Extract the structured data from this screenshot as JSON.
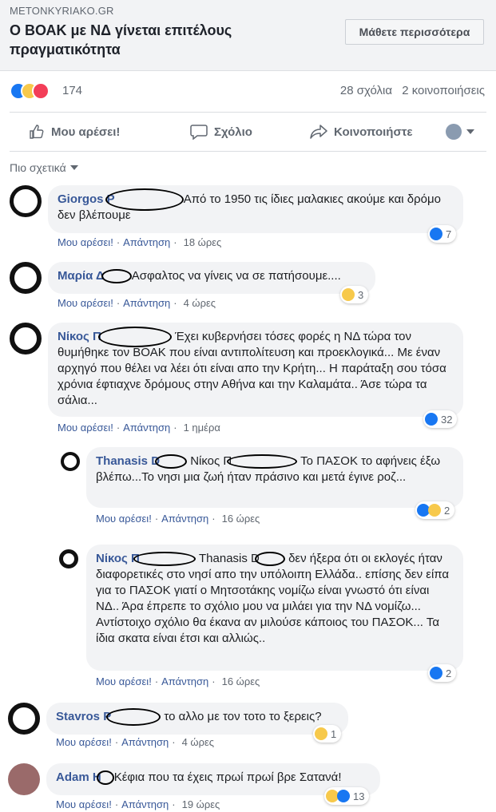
{
  "preview": {
    "domain": "METONKYRIAKO.GR",
    "title": "Ο ΒΟΑΚ με ΝΔ γίνεται επιτέλους πραγματικότητα",
    "learn_more": "Μάθετε περισσότερα"
  },
  "summary": {
    "reactions_count": "174",
    "comments": "28 σχόλια",
    "shares": "2 κοινοποιήσεις"
  },
  "actions": {
    "like": "Μου αρέσει!",
    "comment": "Σχόλιο",
    "share": "Κοινοποιήστε"
  },
  "sort_label": "Πιο σχετικά",
  "meta_like": "Μου αρέσει!",
  "meta_reply": "Απάντηση",
  "comments": [
    {
      "name": "Giorgos P",
      "text": "Από το 1950 τις ίδιες μαλακιες ακούμε και δρόμο δεν βλέπουμε",
      "time": "18 ώρες",
      "reactions": "7"
    },
    {
      "name": "Μαρία Δ",
      "text": "Ασφαλτος να γίνεις να σε πατήσουμε....",
      "time": "4 ώρες",
      "reactions": "3"
    },
    {
      "name": "Νίκος Π",
      "text": "Έχει κυβερνήσει τόσες φορές η ΝΔ τώρα τον θυμήθηκε τον ΒΟΑΚ που είναι αντιπολίτευση και προεκλογικά... Με έναν αρχηγό που θέλει να λέει ότι είναι απο την Κρήτη... Η παράταξη σου τόσα χρόνια έφτιαχνε δρόμους στην Αθήνα και την Καλαμάτα.. Άσε τώρα τα σάλια...",
      "time": "1 ημέρα",
      "reactions": "32"
    },
    {
      "name": "Thanasis D",
      "tag": "Νίκος Π",
      "text": "Το ΠΑΣΟΚ το αφήνεις έξω βλέπω...Το νησι μια ζωή ήταν πράσινο και μετά έγινε ροζ...",
      "time": "16 ώρες",
      "reactions": "2"
    },
    {
      "name": "Νίκος Π",
      "tag": "Thanasis D",
      "text": "δεν ήξερα ότι οι εκλογές ήταν διαφορετικές στο νησί απο την υπόλοιπη Ελλάδα.. επίσης δεν είπα για το ΠΑΣΟΚ γιατί ο Μητσοτάκης νομίζω είναι γνωστό ότι είναι ΝΔ.. Άρα έπρεπε το σχόλιο μου να μιλάει για την ΝΔ νομίζω... Αντίστοιχο σχόλιο θα έκανα αν μιλούσε κάποιος του ΠΑΣΟΚ... Τα ίδια σκατα είναι έτσι και αλλιώς..",
      "time": "16 ώρες",
      "reactions": "2"
    },
    {
      "name": "Stavros P",
      "text": "το αλλο με τον τοτο το ξερεις?",
      "time": "4 ώρες",
      "reactions": "1"
    },
    {
      "name": "Adam H",
      "text": "Κέφια που τα έχεις πρωί πρωί βρε Σατανά!",
      "time": "19 ώρες",
      "reactions": "13"
    }
  ]
}
